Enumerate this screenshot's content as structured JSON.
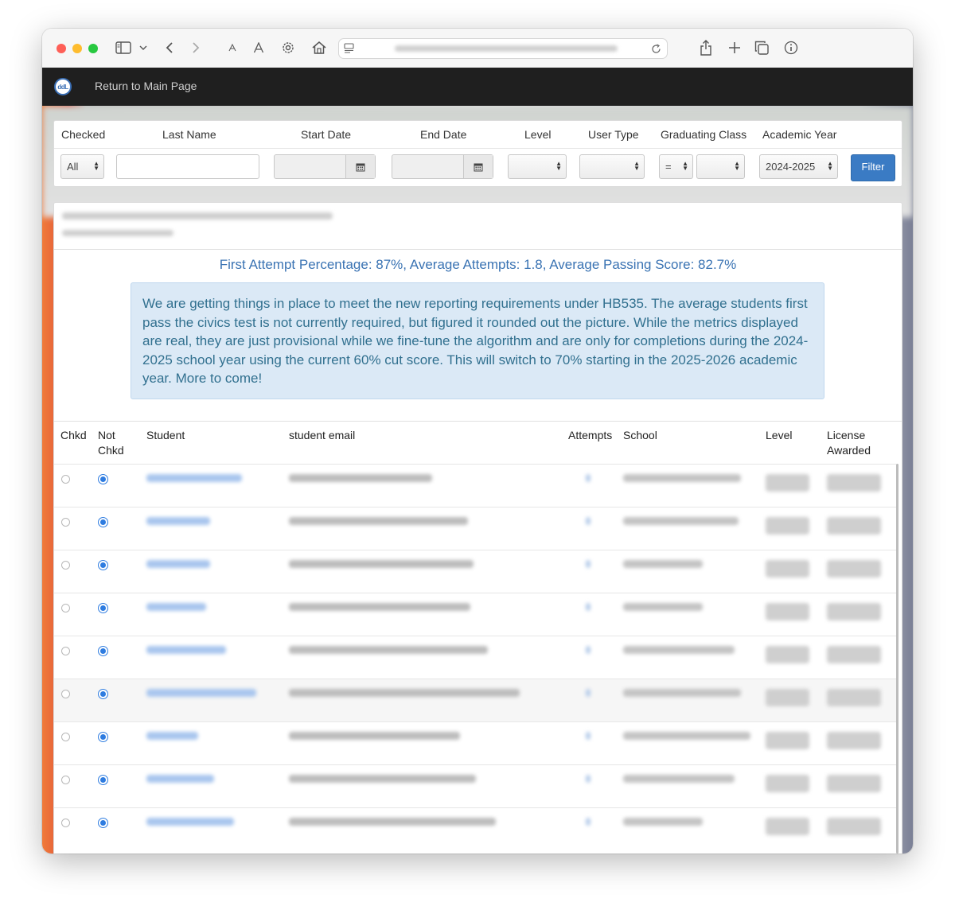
{
  "nav": {
    "return_label": "Return to Main Page",
    "logo_text": "ddL"
  },
  "filters": {
    "headers": {
      "checked": "Checked",
      "last_name": "Last Name",
      "start_date": "Start Date",
      "end_date": "End Date",
      "level": "Level",
      "user_type": "User Type",
      "graduating_class": "Graduating Class",
      "academic_year": "Academic Year"
    },
    "checked_value": "All",
    "last_name_value": "",
    "start_date_value": "",
    "end_date_value": "",
    "level_value": "",
    "user_type_value": "",
    "grad_operator": "=",
    "grad_value": "",
    "academic_year_value": "2024-2025",
    "filter_label": "Filter"
  },
  "report": {
    "stats": "First Attempt Percentage: 87%, Average Attempts: 1.8, Average Passing Score: 82.7%",
    "notice": "We are getting things in place to meet the new reporting requirements under HB535. The average students first pass the civics test is not currently required, but figured it rounded out the picture. While the metrics displayed are real, they are just provisional while we fine-tune the algorithm and are only for completions during the 2024-2025 school year using the current 60% cut score. This will switch to 70% starting in the 2025-2026 academic year. More to come!"
  },
  "table": {
    "headers": {
      "chkd": "Chkd",
      "not_chkd": "Not Chkd",
      "student": "Student",
      "email": "student email",
      "attempts": "Attempts",
      "school": "School",
      "level": "Level",
      "license": "License Awarded"
    },
    "row_count": 9
  },
  "colors": {
    "accent": "#3a7bc4",
    "stats_text": "#3a73b3",
    "notice_bg": "#dbe9f6",
    "notice_text": "#31708f",
    "nav_bg": "#1f1f1f"
  }
}
